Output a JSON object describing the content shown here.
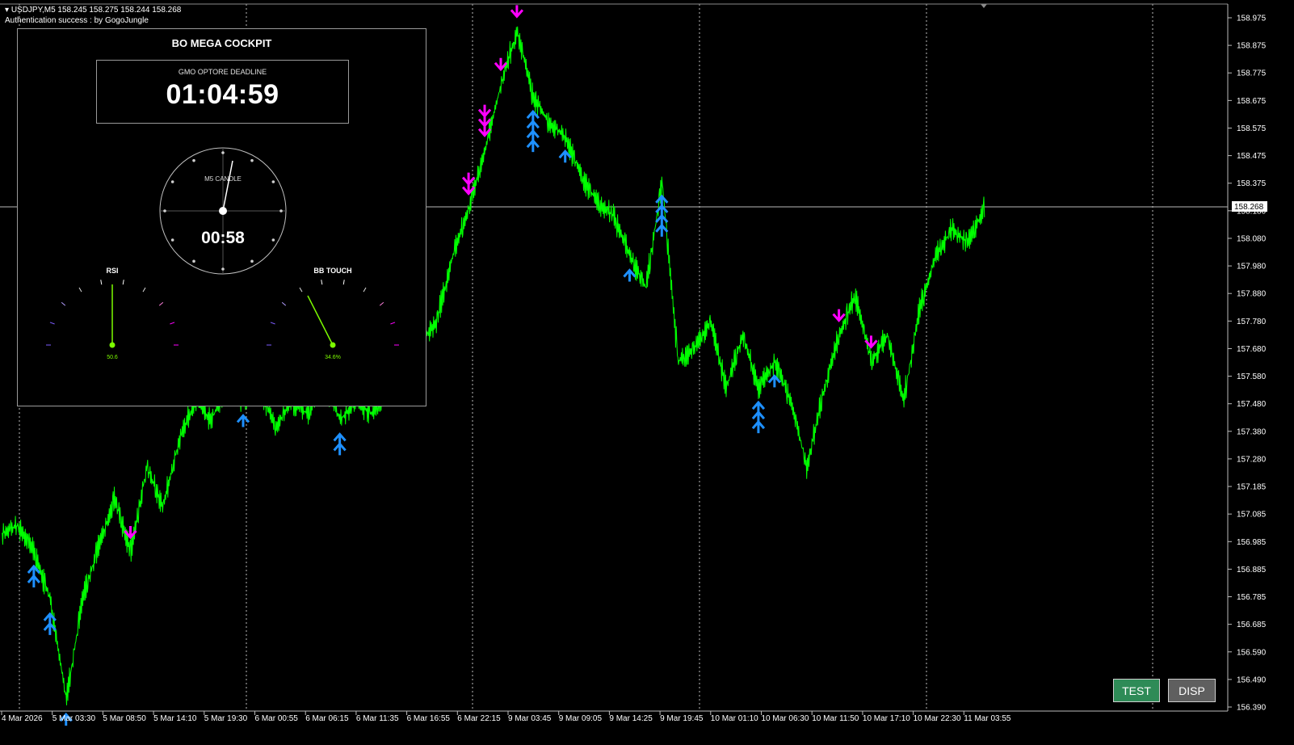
{
  "header": {
    "symbol_line": "USDJPY,M5  158.245 158.275 158.244 158.268",
    "auth_line": "Authentication success : by GogoJungle"
  },
  "cockpit": {
    "title": "BO MEGA COCKPIT",
    "deadline_label": "GMO OPTORE DEADLINE",
    "deadline_value": "01:04:59",
    "clock_label": "M5 CANDLE",
    "clock_value": "00:58",
    "rsi_label": "RSI",
    "rsi_value": "50.6",
    "bb_label": "BB TOUCH",
    "bb_value": "34.6%"
  },
  "buttons": {
    "test_label": "TEST",
    "disp_label": "DISP"
  },
  "current_price": "158.268",
  "colors": {
    "candles": "#00ff00",
    "up_arrow": "#1e90ff",
    "down_arrow": "#ff00ff",
    "price_line": "#b8b8b8"
  },
  "chart_data": {
    "type": "line",
    "symbol": "USDJPY",
    "timeframe": "M5",
    "x_tick_labels": [
      "4 Mar 2026",
      "5 Mar 03:30",
      "5 Mar 08:50",
      "5 Mar 14:10",
      "5 Mar 19:30",
      "6 Mar 00:55",
      "6 Mar 06:15",
      "6 Mar 11:35",
      "6 Mar 16:55",
      "6 Mar 22:15",
      "9 Mar 03:45",
      "9 Mar 09:05",
      "9 Mar 14:25",
      "9 Mar 19:45",
      "10 Mar 01:10",
      "10 Mar 06:30",
      "10 Mar 11:50",
      "10 Mar 17:10",
      "10 Mar 22:30",
      "11 Mar 03:55"
    ],
    "y_tick_labels": [
      "158.975",
      "158.875",
      "158.775",
      "158.675",
      "158.575",
      "158.475",
      "158.375",
      "158.180",
      "158.080",
      "157.980",
      "157.880",
      "157.780",
      "157.680",
      "157.580",
      "157.480",
      "157.380",
      "157.280",
      "157.185",
      "157.085",
      "156.985",
      "156.885",
      "156.785",
      "156.685",
      "156.590",
      "156.490",
      "156.390"
    ],
    "ylim": [
      156.39,
      159.0
    ],
    "series": [
      {
        "x": [
          0,
          1,
          2,
          3,
          4,
          5,
          6,
          7,
          8,
          9,
          10,
          11,
          12,
          13,
          14,
          15,
          16,
          17,
          18,
          19,
          20,
          21,
          22,
          23,
          24,
          25,
          26,
          27,
          28,
          29,
          30,
          31,
          32,
          33,
          34,
          35,
          36,
          37,
          38,
          39,
          40,
          41,
          42,
          43,
          44,
          45,
          46,
          47,
          48,
          49,
          50,
          51,
          52,
          53,
          54,
          55,
          56,
          57,
          58,
          59,
          60,
          61
        ],
        "values": [
          157.05,
          157.08,
          156.98,
          156.8,
          156.42,
          156.8,
          157.0,
          157.18,
          156.98,
          157.3,
          157.15,
          157.4,
          157.55,
          157.48,
          157.6,
          157.55,
          157.6,
          157.45,
          157.55,
          157.5,
          157.62,
          157.48,
          157.55,
          157.5,
          157.6,
          157.7,
          157.78,
          157.85,
          158.1,
          158.28,
          158.5,
          158.75,
          158.95,
          158.7,
          158.6,
          158.55,
          158.4,
          158.3,
          158.25,
          158.1,
          157.98,
          158.38,
          157.7,
          157.75,
          157.85,
          157.6,
          157.8,
          157.6,
          157.7,
          157.55,
          157.3,
          157.58,
          157.8,
          157.95,
          157.7,
          157.8,
          157.55,
          157.9,
          158.1,
          158.2,
          158.15,
          158.28
        ]
      }
    ],
    "up_arrows_x": [
      2,
      2,
      3,
      3,
      4,
      15,
      21,
      21,
      33,
      33,
      33,
      33,
      35,
      39,
      41,
      41,
      41,
      41,
      47,
      47,
      47,
      48
    ],
    "down_arrows_x": [
      8,
      29,
      29,
      30,
      30,
      30,
      31,
      32,
      52,
      54
    ]
  }
}
